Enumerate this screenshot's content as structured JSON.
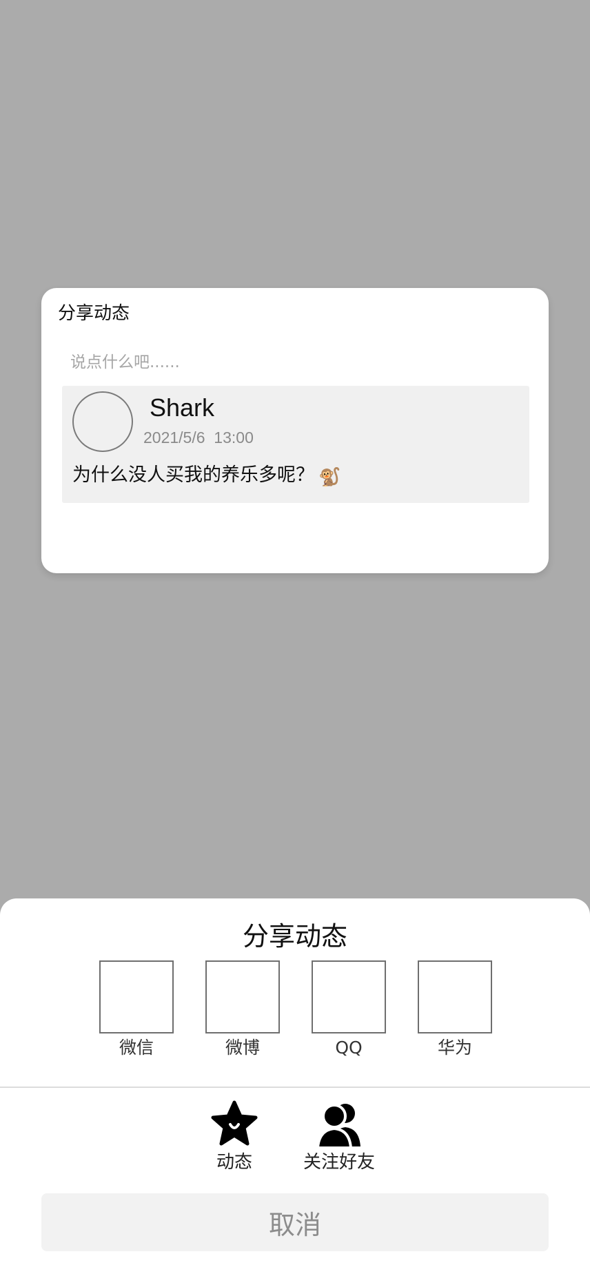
{
  "dialog": {
    "title": "分享动态",
    "comment_placeholder": "说点什么吧......",
    "post": {
      "author": "Shark",
      "time": "2021/5/6  13:00",
      "text": "为什么没人买我的养乐多呢？",
      "emoji": "🐒"
    }
  },
  "share_sheet": {
    "title": "分享动态",
    "platforms": [
      {
        "label": "微信"
      },
      {
        "label": "微博"
      },
      {
        "label": "QQ"
      },
      {
        "label": "华为"
      }
    ],
    "actions": [
      {
        "label": "动态",
        "icon": "star-icon"
      },
      {
        "label": "关注好友",
        "icon": "friends-icon"
      }
    ],
    "cancel_label": "取消"
  },
  "colors": {
    "overlay": "#ababab",
    "surface": "#ffffff",
    "card": "#f0f0f0",
    "muted_text": "#8a8a8a",
    "cancel_bg": "#f2f2f2"
  }
}
